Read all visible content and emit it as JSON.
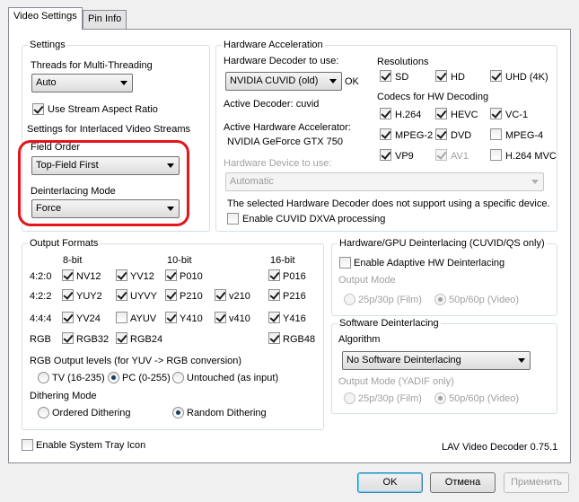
{
  "tabs": [
    "Video Settings",
    "Pin Info"
  ],
  "settings": {
    "legend": "Settings",
    "threads_label": "Threads for Multi-Threading",
    "threads_value": "Auto",
    "stream_aspect": "Use Stream Aspect Ratio",
    "interlaced_label": "Settings for Interlaced Video Streams",
    "field_order_label": "Field Order",
    "field_order_value": "Top-Field First",
    "deint_mode_label": "Deinterlacing Mode",
    "deint_mode_value": "Force"
  },
  "hw": {
    "legend": "Hardware Acceleration",
    "decoder_label": "Hardware Decoder to use:",
    "decoder_value": "NVIDIA CUVID (old)",
    "ok": "OK",
    "active_decoder": "Active Decoder:  cuvid",
    "active_accel_label": "Active Hardware Accelerator:",
    "active_accel_value": "NVIDIA GeForce GTX 750",
    "device_label": "Hardware Device to use:",
    "device_value": "Automatic",
    "warning": "The selected Hardware Decoder does not support using a specific device.",
    "dxva": "Enable CUVID DXVA processing",
    "resolutions_label": "Resolutions",
    "res_sd": "SD",
    "res_hd": "HD",
    "res_uhd": "UHD (4K)",
    "codecs_label": "Codecs for HW Decoding",
    "c_h264": "H.264",
    "c_hevc": "HEVC",
    "c_vc1": "VC-1",
    "c_mpeg2": "MPEG-2",
    "c_dvd": "DVD",
    "c_mpeg4": "MPEG-4",
    "c_vp9": "VP9",
    "c_av1": "AV1",
    "c_h264mvc": "H.264 MVC"
  },
  "formats": {
    "legend": "Output Formats",
    "h8": "8-bit",
    "h10": "10-bit",
    "h16": "16-bit",
    "r420": "4:2:0",
    "r422": "4:2:2",
    "r444": "4:4:4",
    "rrgb": "RGB",
    "nv12": "NV12",
    "yv12": "YV12",
    "p010": "P010",
    "p016": "P016",
    "yuy2": "YUY2",
    "uyvy": "UYVY",
    "p210": "P210",
    "v210": "v210",
    "p216": "P216",
    "yv24": "YV24",
    "ayuv": "AYUV",
    "y410": "Y410",
    "v410": "v410",
    "y416": "Y416",
    "rgb32": "RGB32",
    "rgb24": "RGB24",
    "rgb48": "RGB48",
    "levels_label": "RGB Output levels (for YUV -> RGB conversion)",
    "tv": "TV (16-235)",
    "pc": "PC (0-255)",
    "untouched": "Untouched (as input)",
    "dither_label": "Dithering Mode",
    "ordered": "Ordered Dithering",
    "random": "Random Dithering"
  },
  "hwdeint": {
    "legend": "Hardware/GPU Deinterlacing (CUVID/QS only)",
    "enable": "Enable Adaptive HW Deinterlacing",
    "mode_label": "Output Mode",
    "film": "25p/30p (Film)",
    "video": "50p/60p (Video)"
  },
  "swdeint": {
    "legend": "Software Deinterlacing",
    "algo_label": "Algorithm",
    "algo_value": "No Software Deinterlacing",
    "mode_label": "Output Mode (YADIF only)",
    "film": "25p/30p (Film)",
    "video": "50p/60p (Video)"
  },
  "tray": "Enable System Tray Icon",
  "version": "LAV Video Decoder 0.75.1",
  "buttons": {
    "ok": "OK",
    "cancel": "Отмена",
    "apply": "Применить"
  },
  "colors": {
    "highlight": "#e3141c"
  }
}
